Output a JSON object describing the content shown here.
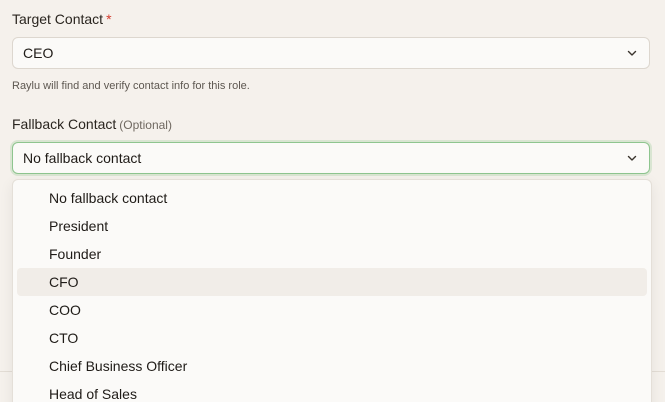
{
  "target": {
    "label": "Target Contact",
    "required_mark": "*",
    "value": "CEO",
    "helper": "Raylu will find and verify contact info for this role."
  },
  "fallback": {
    "label": "Fallback Contact",
    "optional_note": "(Optional)",
    "value": "No fallback contact",
    "options": [
      "No fallback contact",
      "President",
      "Founder",
      "CFO",
      "COO",
      "CTO",
      "Chief Business Officer",
      "Head of Sales"
    ],
    "highlighted_option": "CFO"
  },
  "colors": {
    "background": "#f5f1ec",
    "required": "#d43c2e",
    "focus_ring": "#8ec58f"
  },
  "icons": {
    "select_chevron": "chevron-down-icon"
  }
}
